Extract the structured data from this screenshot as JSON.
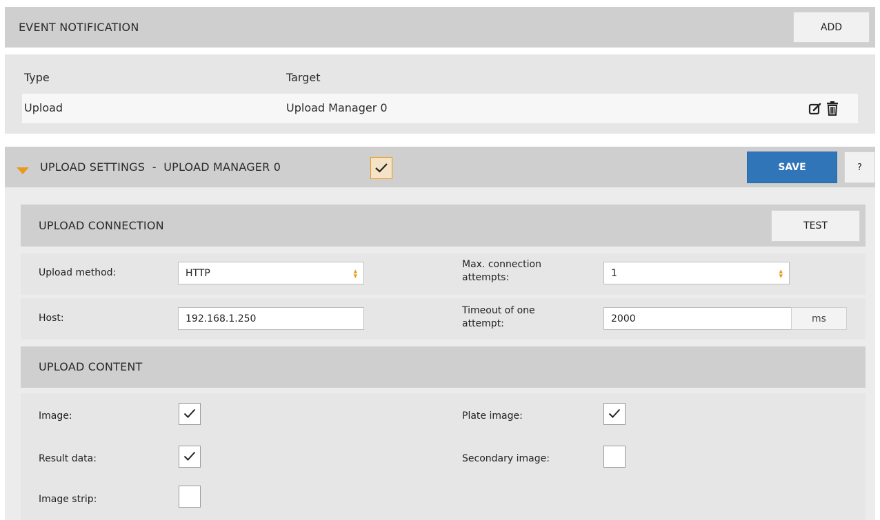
{
  "event_notification": {
    "title": "EVENT NOTIFICATION",
    "add_label": "ADD",
    "columns": [
      "Type",
      "Target"
    ],
    "rows": [
      {
        "type": "Upload",
        "target": "Upload Manager 0"
      }
    ]
  },
  "upload_settings": {
    "title": "UPLOAD SETTINGS  -  UPLOAD MANAGER 0",
    "enabled": true,
    "save_label": "SAVE",
    "help_label": "?"
  },
  "upload_connection": {
    "title": "UPLOAD CONNECTION",
    "test_label": "TEST",
    "method_label": "Upload method:",
    "method_value": "HTTP",
    "attempts_label_1": "Max. connection",
    "attempts_label_2": "attempts:",
    "attempts_value": "1",
    "host_label": "Host:",
    "host_value": "192.168.1.250",
    "timeout_label_1": "Timeout of one",
    "timeout_label_2": "attempt:",
    "timeout_value": "2000",
    "timeout_unit": "ms"
  },
  "upload_content": {
    "title": "UPLOAD CONTENT",
    "items": [
      {
        "label": "Image:",
        "checked": true
      },
      {
        "label": "Plate image:",
        "checked": true
      },
      {
        "label": "Result data:",
        "checked": true
      },
      {
        "label": "Secondary image:",
        "checked": false
      },
      {
        "label": "Image strip:",
        "checked": false
      }
    ]
  },
  "colors": {
    "accent_orange": "#e89a1d",
    "save_blue": "#2f75b8",
    "header_gray": "#cfcfcf",
    "panel_gray": "#e6e6e6"
  },
  "icons": [
    "edit-icon",
    "trash-icon",
    "chevron-down-icon",
    "select-arrows-icon",
    "checkmark-icon"
  ]
}
